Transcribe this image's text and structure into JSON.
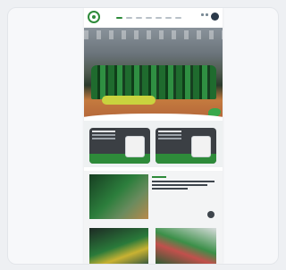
{
  "header": {
    "logo_icon": "club-crest-icon",
    "nav_items": [
      "",
      "",
      "",
      "",
      "",
      "",
      ""
    ],
    "account_icon": "user-avatar-icon"
  },
  "hero": {
    "image": "team-photo-hero"
  },
  "promos": [
    {
      "image": "phone-app-promo"
    },
    {
      "image": "tablet-app-promo"
    }
  ],
  "news": [
    {
      "image": "news-photo-1"
    },
    {
      "image": "news-photo-2"
    },
    {
      "image": "news-photo-3"
    }
  ],
  "colors": {
    "brand": "#2e8b3a",
    "dark": "#3b3f44"
  }
}
